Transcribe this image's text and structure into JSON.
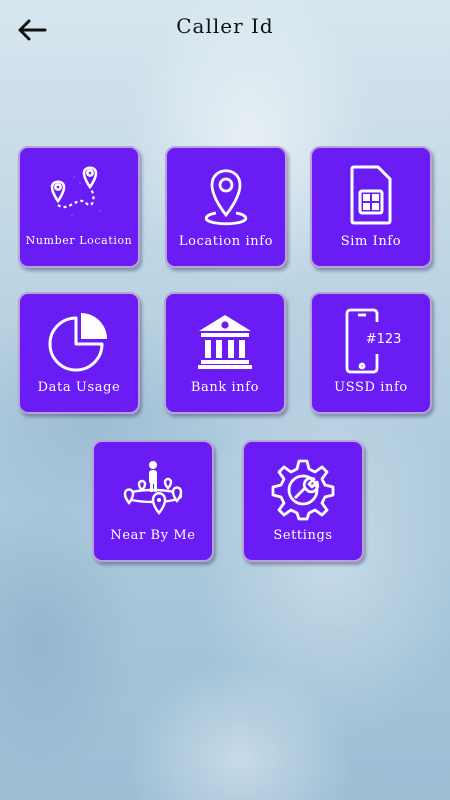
{
  "header": {
    "title": "Caller Id",
    "back_icon": "arrow-left-icon"
  },
  "colors": {
    "tile": "#6a1cf5",
    "tile_border": "#b9a3d6",
    "icon": "#ffffff"
  },
  "tiles": [
    {
      "label": "Number Location",
      "icon": "map-route-icon"
    },
    {
      "label": "Location info",
      "icon": "map-pin-icon"
    },
    {
      "label": "Sim Info",
      "icon": "sim-card-icon"
    },
    {
      "label": "Data Usage",
      "icon": "pie-chart-icon"
    },
    {
      "label": "Bank info",
      "icon": "bank-icon"
    },
    {
      "label": "USSD info",
      "icon": "phone-ussd-icon",
      "icon_text": "#123#"
    },
    {
      "label": "Near By Me",
      "icon": "nearby-people-icon"
    },
    {
      "label": "Settings",
      "icon": "gear-wrench-icon"
    }
  ]
}
